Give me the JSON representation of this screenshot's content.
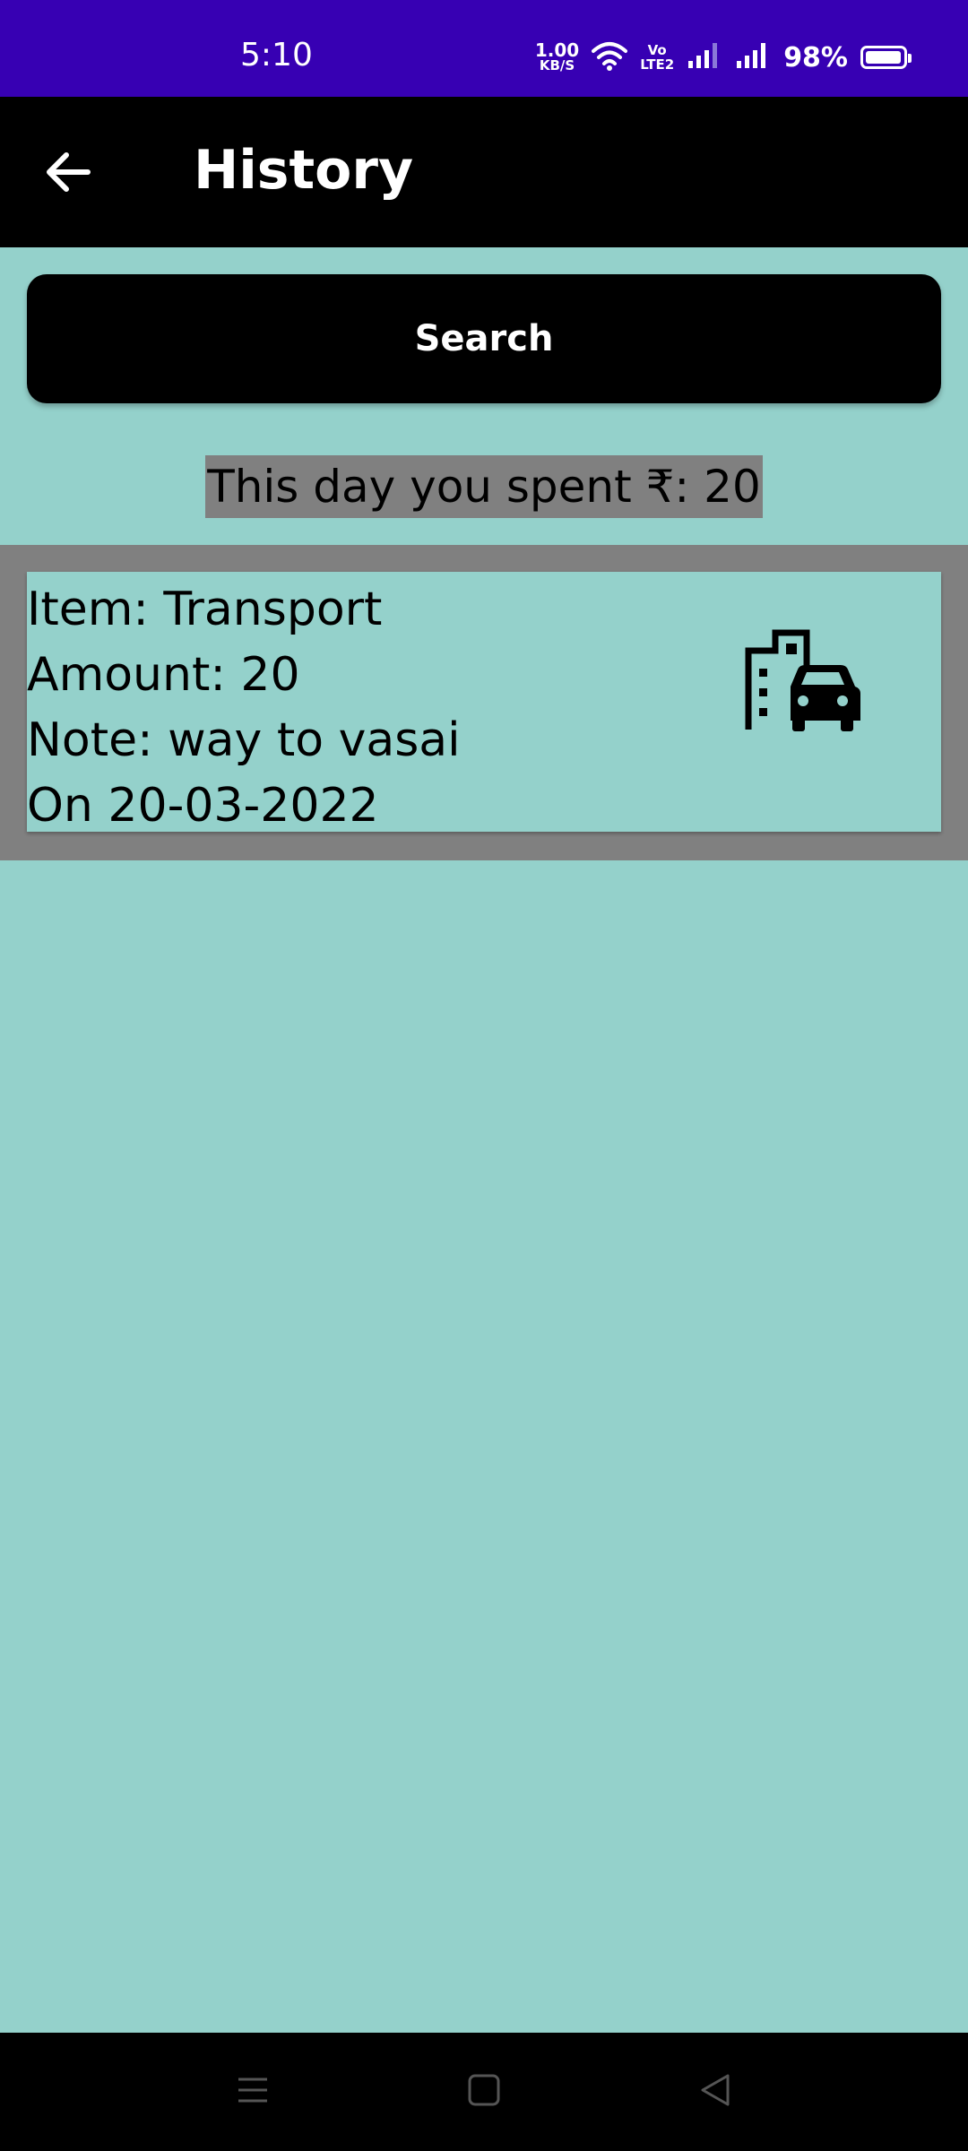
{
  "status_bar": {
    "time": "5:10",
    "net_speed_value": "1.00",
    "net_speed_unit": "KB/S",
    "volte_top": "Vo",
    "volte_bottom": "LTE2",
    "battery_percent": "98%",
    "battery_level": 0.98
  },
  "app_bar": {
    "title": "History",
    "back_icon": "arrow-left-icon"
  },
  "search": {
    "label": "Search"
  },
  "summary": {
    "text": "This day you spent ₹: 20"
  },
  "history": [
    {
      "item": "Item: Transport",
      "amount": "Amount: 20",
      "note": "Note: way to vasai",
      "date": "On 20-03-2022",
      "icon": "city-car-icon"
    }
  ],
  "nav_bar": {
    "menu_icon": "menu-icon",
    "home_icon": "home-square-icon",
    "back_icon": "back-triangle-icon"
  },
  "colors": {
    "status_bar": "#3700b3",
    "app_bar": "#000000",
    "background": "#94d1cb",
    "list_background": "#808080",
    "highlight": "#808080"
  }
}
